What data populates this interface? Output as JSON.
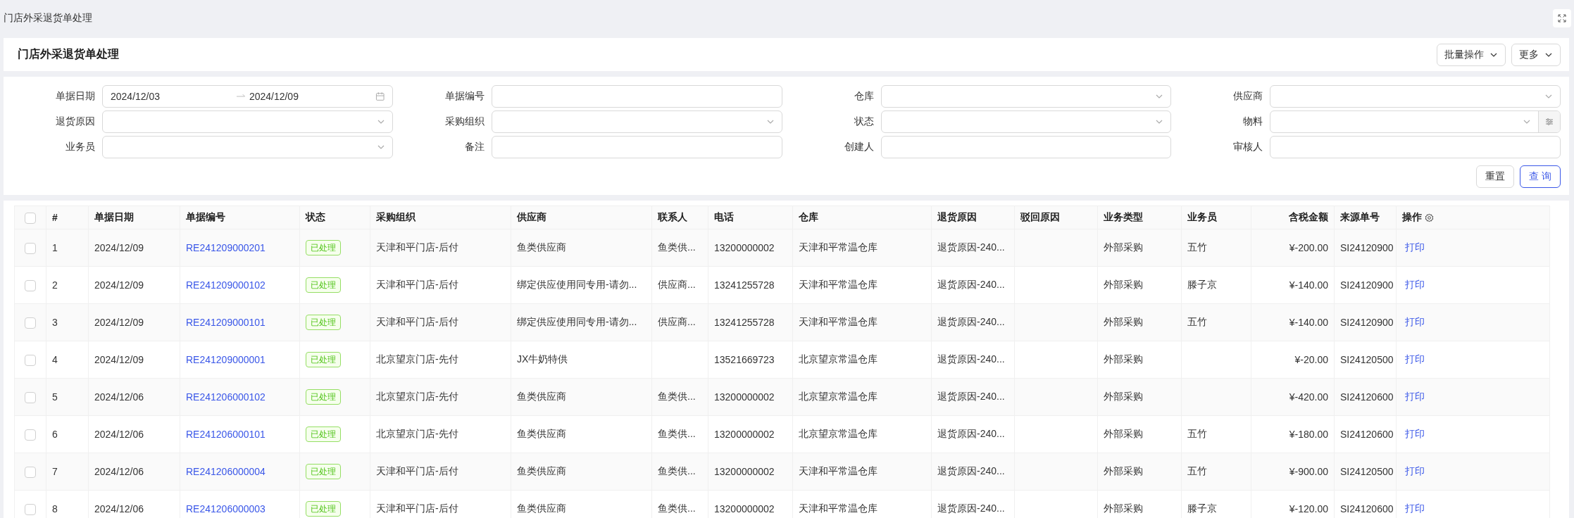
{
  "window": {
    "title": "门店外采退货单处理"
  },
  "page_header": {
    "title": "门店外采退货单处理",
    "actions": [
      {
        "label": "批量操作"
      },
      {
        "label": "更多"
      }
    ]
  },
  "filters": [
    {
      "kind": "date_range",
      "label": "单据日期",
      "start": "2024/12/03",
      "end": "2024/12/09"
    },
    {
      "kind": "input",
      "label": "单据编号"
    },
    {
      "kind": "select",
      "label": "仓库"
    },
    {
      "kind": "select",
      "label": "供应商"
    },
    {
      "kind": "select",
      "label": "退货原因"
    },
    {
      "kind": "select",
      "label": "采购组织"
    },
    {
      "kind": "select",
      "label": "状态"
    },
    {
      "kind": "select_filter",
      "label": "物料"
    },
    {
      "kind": "select",
      "label": "业务员"
    },
    {
      "kind": "input",
      "label": "备注"
    },
    {
      "kind": "input",
      "label": "创建人"
    },
    {
      "kind": "input",
      "label": "审核人"
    }
  ],
  "filter_buttons": [
    {
      "label": "重置",
      "primary": false
    },
    {
      "label": "查 询",
      "primary": true
    }
  ],
  "table": {
    "all_checked": false,
    "columns": [
      "#",
      "单据日期",
      "单据编号",
      "状态",
      "采购组织",
      "供应商",
      "联系人",
      "电话",
      "仓库",
      "退货原因",
      "驳回原因",
      "业务类型",
      "业务员",
      "含税金额",
      "来源单号",
      "操作"
    ],
    "rows": [
      {
        "checked": false,
        "cells": [
          "1",
          "2024/12/09",
          "RE241209000201",
          "已处理",
          "天津和平门店-后付",
          "鱼类供应商",
          "鱼类供...",
          "13200000002",
          "天津和平常温仓库",
          "退货原因-240...",
          "",
          "外部采购",
          "五竹",
          "¥-200.00",
          "SI24120900",
          "打印"
        ]
      },
      {
        "checked": false,
        "cells": [
          "2",
          "2024/12/09",
          "RE241209000102",
          "已处理",
          "天津和平门店-后付",
          "绑定供应使用同专用-请勿...",
          "供应商...",
          "13241255728",
          "天津和平常温仓库",
          "退货原因-240...",
          "",
          "外部采购",
          "滕子京",
          "¥-140.00",
          "SI24120900",
          "打印"
        ]
      },
      {
        "checked": false,
        "cells": [
          "3",
          "2024/12/09",
          "RE241209000101",
          "已处理",
          "天津和平门店-后付",
          "绑定供应使用同专用-请勿...",
          "供应商...",
          "13241255728",
          "天津和平常温仓库",
          "退货原因-240...",
          "",
          "外部采购",
          "五竹",
          "¥-140.00",
          "SI24120900",
          "打印"
        ]
      },
      {
        "checked": false,
        "cells": [
          "4",
          "2024/12/09",
          "RE241209000001",
          "已处理",
          "北京望京门店-先付",
          "JX牛奶特供",
          "",
          "13521669723",
          "北京望京常温仓库",
          "退货原因-240...",
          "",
          "外部采购",
          "",
          "¥-20.00",
          "SI24120500",
          "打印"
        ]
      },
      {
        "checked": false,
        "cells": [
          "5",
          "2024/12/06",
          "RE241206000102",
          "已处理",
          "北京望京门店-先付",
          "鱼类供应商",
          "鱼类供...",
          "13200000002",
          "北京望京常温仓库",
          "退货原因-240...",
          "",
          "外部采购",
          "",
          "¥-420.00",
          "SI24120600",
          "打印"
        ]
      },
      {
        "checked": false,
        "cells": [
          "6",
          "2024/12/06",
          "RE241206000101",
          "已处理",
          "北京望京门店-先付",
          "鱼类供应商",
          "鱼类供...",
          "13200000002",
          "北京望京常温仓库",
          "退货原因-240...",
          "",
          "外部采购",
          "五竹",
          "¥-180.00",
          "SI24120600",
          "打印"
        ]
      },
      {
        "checked": false,
        "cells": [
          "7",
          "2024/12/06",
          "RE241206000004",
          "已处理",
          "天津和平门店-后付",
          "鱼类供应商",
          "鱼类供...",
          "13200000002",
          "天津和平常温仓库",
          "退货原因-240...",
          "",
          "外部采购",
          "五竹",
          "¥-900.00",
          "SI24120500",
          "打印"
        ]
      },
      {
        "checked": false,
        "cells": [
          "8",
          "2024/12/06",
          "RE241206000003",
          "已处理",
          "天津和平门店-后付",
          "鱼类供应商",
          "鱼类供...",
          "13200000002",
          "天津和平常温仓库",
          "退货原因-240...",
          "",
          "外部采购",
          "滕子京",
          "¥-120.00",
          "SI24120600",
          "打印"
        ]
      }
    ]
  }
}
